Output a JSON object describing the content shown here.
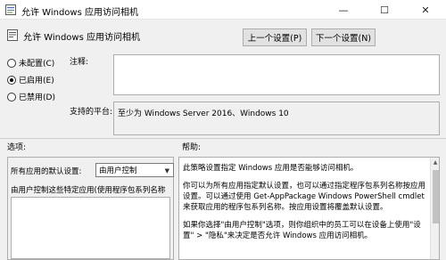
{
  "window": {
    "title": "允许 Windows 应用访问相机",
    "minimize_glyph": "—",
    "maximize_glyph": "☐",
    "close_glyph": "✕"
  },
  "header": {
    "policy_title": "允许 Windows 应用访问相机",
    "prev_button": "上一个设置(P)",
    "next_button": "下一个设置(N)"
  },
  "state": {
    "options": [
      {
        "label": "未配置(C)",
        "checked": false
      },
      {
        "label": "已启用(E)",
        "checked": true
      },
      {
        "label": "已禁用(D)",
        "checked": false
      }
    ]
  },
  "comment": {
    "label": "注释:",
    "value": ""
  },
  "platform": {
    "label": "支持的平台:",
    "value": "至少为 Windows Server 2016、Windows 10"
  },
  "options_section": {
    "heading": "选项:",
    "default_label": "所有应用的默认设置:",
    "default_value": "由用户控制",
    "list_text": "由用户控制这些特定应用(使用程序包系列名称"
  },
  "help_section": {
    "heading": "帮助:",
    "paragraphs": [
      "此策略设置指定 Windows 应用是否能够访问相机。",
      "你可以为所有应用指定默认设置，也可以通过指定程序包系列名称按应用设置。可以通过使用 Get-AppPackage Windows PowerShell cmdlet 来获取应用的程序包系列名称。按应用设置将覆盖默认设置。",
      "如果你选择\"由用户控制\"选项，则你组织中的员工可以在设备上使用\"设置\" > \"隐私\"来决定是否允许 Windows 应用访问相机。"
    ]
  }
}
